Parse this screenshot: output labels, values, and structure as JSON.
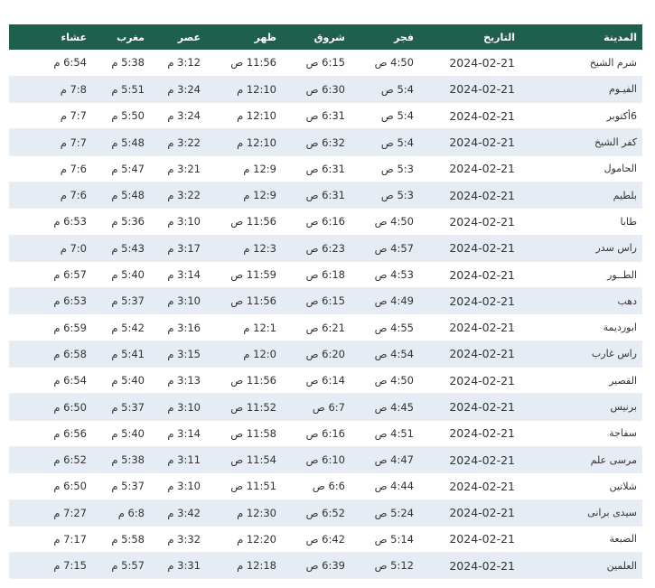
{
  "table": {
    "headers": [
      "المدينة",
      "التاريخ",
      "فجر",
      "شروق",
      "ظهر",
      "عصر",
      "مغرب",
      "عشاء"
    ],
    "rows": [
      [
        "شرم الشيخ",
        "2024-02-21",
        "4:50 ص",
        "6:15 ص",
        "11:56 ص",
        "3:12 م",
        "5:38 م",
        "6:54 م"
      ],
      [
        "الفيـوم",
        "2024-02-21",
        "5:4 ص",
        "6:30 ص",
        "12:10 م",
        "3:24 م",
        "5:51 م",
        "7:8 م"
      ],
      [
        "6أكتوبر",
        "2024-02-21",
        "5:4 ص",
        "6:31 ص",
        "12:10 م",
        "3:24 م",
        "5:50 م",
        "7:7 م"
      ],
      [
        "كفر الشيخ",
        "2024-02-21",
        "5:4 ص",
        "6:32 ص",
        "12:10 م",
        "3:22 م",
        "5:48 م",
        "7:7 م"
      ],
      [
        "الحامول",
        "2024-02-21",
        "5:3 ص",
        "6:31 ص",
        "12:9 م",
        "3:21 م",
        "5:47 م",
        "7:6 م"
      ],
      [
        "بلطيم",
        "2024-02-21",
        "5:3 ص",
        "6:31 ص",
        "12:9 م",
        "3:22 م",
        "5:48 م",
        "7:6 م"
      ],
      [
        "طابا",
        "2024-02-21",
        "4:50 ص",
        "6:16 ص",
        "11:56 ص",
        "3:10 م",
        "5:36 م",
        "6:53 م"
      ],
      [
        "راس سدر",
        "2024-02-21",
        "4:57 ص",
        "6:23 ص",
        "12:3 م",
        "3:17 م",
        "5:43 م",
        "7:0 م"
      ],
      [
        "الطــور",
        "2024-02-21",
        "4:53 ص",
        "6:18 ص",
        "11:59 ص",
        "3:14 م",
        "5:40 م",
        "6:57 م"
      ],
      [
        "دهب",
        "2024-02-21",
        "4:49 ص",
        "6:15 ص",
        "11:56 ص",
        "3:10 م",
        "5:37 م",
        "6:53 م"
      ],
      [
        "ابورديمة",
        "2024-02-21",
        "4:55 ص",
        "6:21 ص",
        "12:1 م",
        "3:16 م",
        "5:42 م",
        "6:59 م"
      ],
      [
        "راس غارب",
        "2024-02-21",
        "4:54 ص",
        "6:20 ص",
        "12:0 م",
        "3:15 م",
        "5:41 م",
        "6:58 م"
      ],
      [
        "القصير",
        "2024-02-21",
        "4:50 ص",
        "6:14 ص",
        "11:56 ص",
        "3:13 م",
        "5:40 م",
        "6:54 م"
      ],
      [
        "برنيس",
        "2024-02-21",
        "4:45 ص",
        "6:7 ص",
        "11:52 ص",
        "3:10 م",
        "5:37 م",
        "6:50 م"
      ],
      [
        "سفاجة",
        "2024-02-21",
        "4:51 ص",
        "6:16 ص",
        "11:58 ص",
        "3:14 م",
        "5:40 م",
        "6:56 م"
      ],
      [
        "مرسى علم",
        "2024-02-21",
        "4:47 ص",
        "6:10 ص",
        "11:54 ص",
        "3:11 م",
        "5:38 م",
        "6:52 م"
      ],
      [
        "شلاتين",
        "2024-02-21",
        "4:44 ص",
        "6:6 ص",
        "11:51 ص",
        "3:10 م",
        "5:37 م",
        "6:50 م"
      ],
      [
        "سيدى برانى",
        "2024-02-21",
        "5:24 ص",
        "6:52 ص",
        "12:30 م",
        "3:42 م",
        "6:8 م",
        "7:27 م"
      ],
      [
        "الضبعة",
        "2024-02-21",
        "5:14 ص",
        "6:42 ص",
        "12:20 م",
        "3:32 م",
        "5:58 م",
        "7:17 م"
      ],
      [
        "العلمين",
        "2024-02-21",
        "5:12 ص",
        "6:39 ص",
        "12:18 م",
        "3:31 م",
        "5:57 م",
        "7:15 م"
      ]
    ]
  },
  "colors": {
    "header_bg": "#1f5f4d",
    "header_text": "#ffffff",
    "row_alt_bg": "#e6ecf3"
  }
}
